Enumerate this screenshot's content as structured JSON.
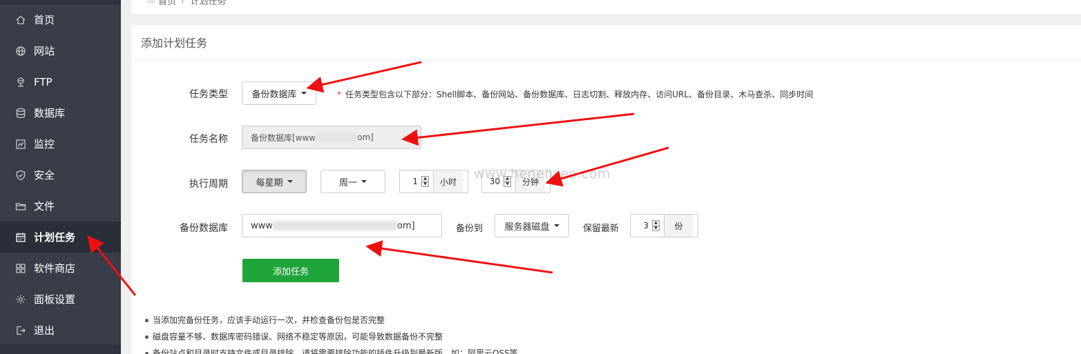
{
  "sidebar": {
    "items": [
      {
        "label": "首页",
        "icon": "home-icon"
      },
      {
        "label": "网站",
        "icon": "globe-icon"
      },
      {
        "label": "FTP",
        "icon": "ftp-icon"
      },
      {
        "label": "数据库",
        "icon": "database-icon"
      },
      {
        "label": "监控",
        "icon": "monitor-icon"
      },
      {
        "label": "安全",
        "icon": "shield-icon"
      },
      {
        "label": "文件",
        "icon": "folder-icon"
      },
      {
        "label": "计划任务",
        "icon": "calendar-icon",
        "active": true
      },
      {
        "label": "软件商店",
        "icon": "grid-icon"
      },
      {
        "label": "面板设置",
        "icon": "gear-icon"
      },
      {
        "label": "退出",
        "icon": "logout-icon"
      }
    ]
  },
  "breadcrumb": {
    "home": "首页",
    "current": "计划任务"
  },
  "card": {
    "title": "添加计划任务"
  },
  "form": {
    "task_type": {
      "label": "任务类型",
      "value": "备份数据库",
      "hint": "任务类型包含以下部分：Shell脚本、备份网站、备份数据库、日志切割、释放内存、访问URL、备份目录、木马查杀、同步时间"
    },
    "task_name": {
      "label": "任务名称",
      "value_prefix": "备份数据库[www",
      "value_suffix": "om]"
    },
    "cycle": {
      "label": "执行周期",
      "period": "每星期",
      "weekday": "周一",
      "hour": "1",
      "hour_unit": "小时",
      "minute": "30",
      "minute_unit": "分钟"
    },
    "backup_db": {
      "label": "备份数据库",
      "value_prefix": "www",
      "value_suffix": "om]",
      "backup_to_label": "备份到",
      "backup_to": "服务器磁盘",
      "keep_label": "保留最新",
      "keep_value": "3",
      "keep_unit": "份"
    },
    "submit": "添加任务"
  },
  "tips": [
    "当添加完备份任务，应该手动运行一次，并检查备份包是否完整",
    "磁盘容量不够、数据库密码错误、网络不稳定等原因，可能导致数据备份不完整",
    "备份站点和目录时支持文件或目录排除，请将需要排除功能的插件升级到最新版，如：阿里云OSS等"
  ],
  "watermark": "www.henenseo.com",
  "colors": {
    "sidebar": "#393d49",
    "accent_green": "#20a53a",
    "annotation_red": "#ee1111"
  }
}
